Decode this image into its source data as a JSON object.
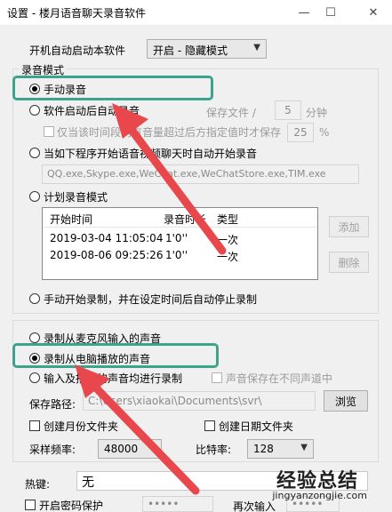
{
  "window": {
    "title": "设置 - 楼月语音聊天录音软件",
    "minimize_glyph": "—",
    "maximize_glyph": "☐",
    "close_glyph": "✕"
  },
  "startup": {
    "label": "开机自动启动本软件",
    "combo_value": "开启 - 隐藏模式"
  },
  "record_mode": {
    "legend": "录音模式",
    "manual": "手动录音",
    "auto_on_start": "软件启动后自动录音",
    "save_file_label": "保存文件 /",
    "save_file_value": "5",
    "minutes_unit": "分钟",
    "only_when_volume": "仅当该时间段内有音量超过后方指定值时才保存",
    "volume_value": "25",
    "percent_unit": "%",
    "auto_on_programs": "当如下程序开始语音视频聊天时自动开始录音",
    "programs_value": "QQ.exe,Skype.exe,WeChat.exe,WeChatStore.exe,TIM.exe",
    "scheduled": "计划录音模式",
    "schedule_table": {
      "headers": [
        "开始时间",
        "录音时长",
        "类型"
      ],
      "rows": [
        [
          "2019-03-04 11:05:04",
          "1'0''",
          "一次"
        ],
        [
          "2019-08-06 09:25:26",
          "1'0''",
          "一次"
        ]
      ]
    },
    "add_button": "添加",
    "delete_button": "删除",
    "manual_start_auto_stop": "手动开始录制，并在设定时间后自动停止录制"
  },
  "source": {
    "from_mic": "录制从麦克风输入的声音",
    "from_playback": "录制从电脑播放的声音",
    "both": "输入及播放的声音均进行录制",
    "separate_channels": "声音保存在不同声道中"
  },
  "save_path": {
    "label": "保存路径:",
    "value": "C:\\Users\\xiaokai\\Documents\\svr\\",
    "browse": "浏览",
    "monthly_folder": "创建月份文件夹",
    "date_folder": "创建日期文件夹"
  },
  "audio": {
    "sample_rate_label": "采样频率:",
    "sample_rate_value": "48000",
    "bitrate_label": "比特率:",
    "bitrate_value": "128"
  },
  "hotkey": {
    "label": "热键:",
    "value": "无"
  },
  "password": {
    "enable_label": "开启密码保护",
    "value": "•••••",
    "reenter_label": "再次输入",
    "reenter_value": "•••••"
  },
  "watermark": {
    "logo": "经验总结",
    "url": "jingyanzongjie.com"
  },
  "colors": {
    "highlight_box": "#3da38d",
    "arrow": "#e8474c",
    "window_bg": "#f0f0f0"
  }
}
